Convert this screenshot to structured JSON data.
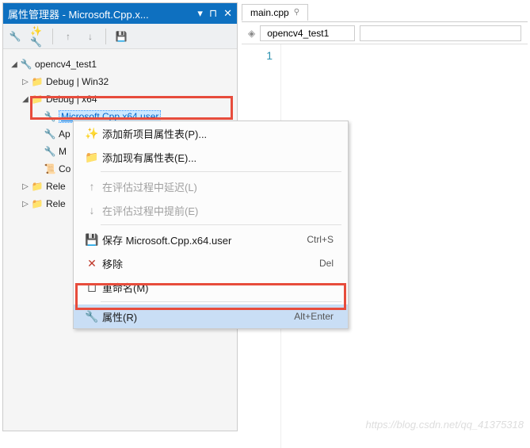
{
  "panel": {
    "title": "属性管理器 - Microsoft.Cpp.x..."
  },
  "tree": {
    "root": "opencv4_test1",
    "debug_win32": "Debug | Win32",
    "debug_x64": "Debug | x64",
    "selected_node": "Microsoft.Cpp.x64.user",
    "app_node": "Ap",
    "m_node": "M",
    "core_node": "Co",
    "release_win32": "Rele",
    "release_x64": "Rele"
  },
  "tab": {
    "label": "main.cpp"
  },
  "editor": {
    "dropdown": "opencv4_test1",
    "line1": "1"
  },
  "context_menu": {
    "add_new": "添加新项目属性表(P)...",
    "add_existing": "添加现有属性表(E)...",
    "defer": "在评估过程中延迟(L)",
    "advance": "在评估过程中提前(E)",
    "save": "保存 Microsoft.Cpp.x64.user",
    "save_shortcut": "Ctrl+S",
    "remove": "移除",
    "remove_shortcut": "Del",
    "rename": "重命名(M)",
    "properties": "属性(R)",
    "properties_shortcut": "Alt+Enter"
  },
  "watermark": "https://blog.csdn.net/qq_41375318"
}
